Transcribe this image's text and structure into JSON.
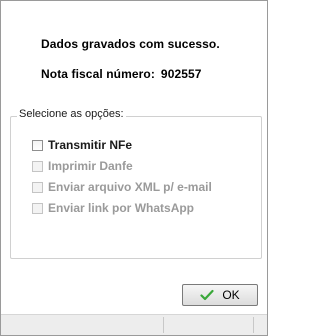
{
  "dialog": {
    "message_line1": "Dados gravados com sucesso.",
    "message_line2_label": "Nota fiscal número:",
    "message_line2_value": "902557"
  },
  "options_group": {
    "legend": "Selecione as opções:",
    "items": [
      {
        "label": "Transmitir NFe",
        "checked": false,
        "enabled": true
      },
      {
        "label": "Imprimir Danfe",
        "checked": false,
        "enabled": false
      },
      {
        "label": "Enviar arquivo XML p/ e-mail",
        "checked": false,
        "enabled": false
      },
      {
        "label": "Enviar link por WhatsApp",
        "checked": false,
        "enabled": false
      }
    ]
  },
  "buttons": {
    "ok_label": "OK",
    "ok_icon": "checkmark-icon",
    "ok_icon_color": "#3aa83a"
  }
}
